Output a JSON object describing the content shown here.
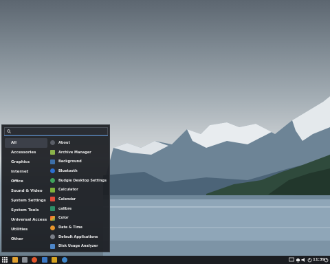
{
  "search": {
    "value": "",
    "placeholder": ""
  },
  "categories": [
    {
      "label": "All",
      "active": true
    },
    {
      "label": "Accessories"
    },
    {
      "label": "Graphics"
    },
    {
      "label": "Internet"
    },
    {
      "label": "Office"
    },
    {
      "label": "Sound & Video"
    },
    {
      "label": "System Settings"
    },
    {
      "label": "System Tools"
    },
    {
      "label": "Universal Access"
    },
    {
      "label": "Utilities"
    },
    {
      "label": "Other"
    }
  ],
  "apps": [
    {
      "label": "About",
      "icon": "info-icon",
      "color": "#5a5e66"
    },
    {
      "label": "Archive Manager",
      "icon": "archive-icon",
      "color": "#8ab34a"
    },
    {
      "label": "Background",
      "icon": "background-icon",
      "color": "#3d6fa8"
    },
    {
      "label": "Bluetooth",
      "icon": "bluetooth-icon",
      "color": "#2c6fd0"
    },
    {
      "label": "Budgie Desktop Settings",
      "icon": "budgie-icon",
      "color": "#3fa35c"
    },
    {
      "label": "Calculator",
      "icon": "calculator-icon",
      "color": "#7fb23c"
    },
    {
      "label": "Calendar",
      "icon": "calendar-icon",
      "color": "#e04a3a"
    },
    {
      "label": "calibre",
      "icon": "calibre-icon",
      "color": "#2e8f68"
    },
    {
      "label": "Color",
      "icon": "color-icon",
      "color": "#e86a2c"
    },
    {
      "label": "Date & Time",
      "icon": "clock-icon",
      "color": "#e8962c"
    },
    {
      "label": "Default Applications",
      "icon": "star-icon",
      "color": "#7a7f88"
    },
    {
      "label": "Disk Usage Analyzer",
      "icon": "disk-usage-icon",
      "color": "#4d86c8"
    }
  ],
  "panel": {
    "clock": "11:39",
    "launchers": [
      {
        "name": "app-grid-icon",
        "color": "#ffffff"
      },
      {
        "name": "file-manager-icon",
        "color": "#e0a030"
      },
      {
        "name": "text-editor-icon",
        "color": "#8a8f96"
      },
      {
        "name": "firefox-icon",
        "color": "#e2562b"
      },
      {
        "name": "software-center-icon",
        "color": "#3b78c4"
      },
      {
        "name": "settings-icon",
        "color": "#d6a21f"
      },
      {
        "name": "update-icon",
        "color": "#3f86c9"
      }
    ]
  }
}
